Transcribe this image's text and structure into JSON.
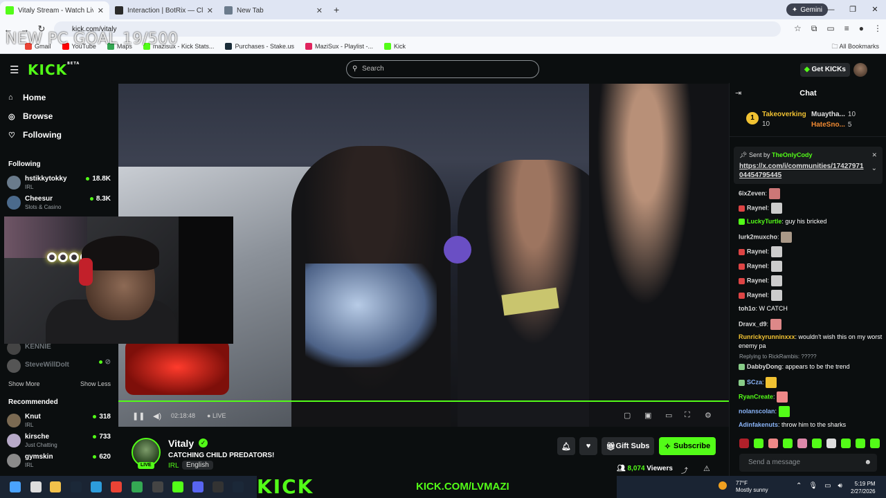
{
  "browser": {
    "tabs": [
      {
        "title": "Vitaly Stream - Watch Live on Kick",
        "active": true,
        "favicon_color": "#53fc18"
      },
      {
        "title": "Interaction | BotRix — Cloud St",
        "active": false,
        "favicon_color": "#2b2b2b"
      },
      {
        "title": "New Tab",
        "active": false,
        "favicon_color": "#6b7b8c"
      }
    ],
    "new_tab": "+",
    "gemini": "Gemini",
    "url": "kick.com/vitaly",
    "bookmarks": [
      {
        "label": "Gmail",
        "color": "#ea4335"
      },
      {
        "label": "YouTube",
        "color": "#ff0000"
      },
      {
        "label": "Maps",
        "color": "#34a853"
      },
      {
        "label": "mazisux - Kick Stats...",
        "color": "#53fc18"
      },
      {
        "label": "Purchases - Stake.us",
        "color": "#1a2c38"
      },
      {
        "label": "MaziSux - Playlist -...",
        "color": "#e0245e"
      },
      {
        "label": "Kick",
        "color": "#53fc18"
      }
    ],
    "all_bookmarks": "All Bookmarks"
  },
  "overlay": {
    "goal_text": "NEW PC GOAL 19/500"
  },
  "header": {
    "logo": "KICK",
    "logo_beta": "BETA",
    "search_placeholder": "Search",
    "get_kicks": "Get KICKs"
  },
  "sidebar": {
    "nav": [
      {
        "label": "Home",
        "icon": "home-icon"
      },
      {
        "label": "Browse",
        "icon": "browse-icon"
      },
      {
        "label": "Following",
        "icon": "heart-icon"
      }
    ],
    "following_heading": "Following",
    "following": [
      {
        "name": "hstikkytokky",
        "category": "IRL",
        "viewers": "18.8K",
        "color": "#6a7b8c"
      },
      {
        "name": "Cheesur",
        "category": "Slots & Casino",
        "viewers": "8.3K",
        "color": "#4b6a8c"
      }
    ],
    "offline": [
      {
        "name": "KENNIE",
        "color": "#444"
      },
      {
        "name": "SteveWillDoIt",
        "color": "#555"
      }
    ],
    "show_more": "Show More",
    "show_less": "Show Less",
    "recommended_heading": "Recommended",
    "recommended": [
      {
        "name": "Knut",
        "category": "IRL",
        "viewers": "318",
        "color": "#7b6a52"
      },
      {
        "name": "kirsche",
        "category": "Just Chatting",
        "viewers": "733",
        "color": "#b7a9c8"
      },
      {
        "name": "gymskin",
        "category": "IRL",
        "viewers": "620",
        "color": "#8a8a8a"
      }
    ]
  },
  "player": {
    "time": "02:18:48",
    "live_label": "LIVE",
    "progress_fraction": 1.0
  },
  "stream": {
    "name": "Vitaly",
    "title": "CATCHING CHILD PREDATORS!",
    "category": "IRL",
    "language": "English",
    "live_badge": "LIVE",
    "gift_subs": "Gift Subs",
    "subscribe": "Subscribe",
    "viewers_count": "8,074",
    "viewers_label": "Viewers"
  },
  "chat": {
    "title": "Chat",
    "leaderboard": [
      {
        "rank": "1",
        "name": "Takeoverking",
        "count": "10",
        "color": "#f1c232"
      },
      {
        "name": "Muaytha...",
        "count": "10",
        "color": "#e0e0e0"
      },
      {
        "name": "HateSno...",
        "count": "5",
        "color": "#f18a32"
      }
    ],
    "pinned": {
      "sent_by_label": "Sent by",
      "sender": "TheOnlyCody",
      "link": "https://x.com/i/communities/1742797104454795445"
    },
    "messages": [
      {
        "user": "6ixZeven",
        "text": "",
        "color": "#ddd",
        "emote": "#c77"
      },
      {
        "user": "Raynel",
        "text": "",
        "color": "#ddd",
        "emote": "#ccc"
      },
      {
        "user": "LuckyTurtle",
        "text": "guy his bricked",
        "color": "#53fc18"
      },
      {
        "user": "lurk2muxcho",
        "text": "",
        "color": "#ddd",
        "emote": "#a98"
      },
      {
        "user": "Raynel",
        "text": "",
        "color": "#ddd",
        "emote": "#ccc"
      },
      {
        "user": "Raynel",
        "text": "",
        "color": "#ddd",
        "emote": "#ccc"
      },
      {
        "user": "Raynel",
        "text": "",
        "color": "#ddd",
        "emote": "#ccc"
      },
      {
        "user": "Raynel",
        "text": "",
        "color": "#ddd",
        "emote": "#ccc"
      },
      {
        "user": "toh1o",
        "text": "W CATCH",
        "color": "#ddd"
      },
      {
        "user": "Dravx_d9",
        "text": "",
        "color": "#ddd",
        "emote": "#d88"
      },
      {
        "user": "Runrickyrunninxxx",
        "text": "wouldn't wish this on my worst enemy pa",
        "color": "#f1c232"
      },
      {
        "user": "DabbyDong",
        "text": "appears to be the trend",
        "color": "#ddd",
        "reply": "Replying to RickRambis: ?????"
      },
      {
        "user": "SCza",
        "text": "",
        "color": "#8ab4f8",
        "emote": "#f1c232"
      },
      {
        "user": "RyanCreate",
        "text": "",
        "color": "#53fc18",
        "emote": "#e88"
      },
      {
        "user": "nolanscolan",
        "text": "",
        "color": "#8ab4f8",
        "emote": "#53fc18"
      },
      {
        "user": "Adinfakenuts",
        "text": "throw him to the sharks",
        "color": "#8ab4f8"
      }
    ],
    "send_placeholder": "Send a message"
  },
  "taskbar": {
    "banner_big": "KICK",
    "banner_url": "KICK.COM/LVMAZI",
    "weather_temp": "77°F",
    "weather_desc": "Mostly sunny",
    "time": "5:19 PM",
    "date": "2/27/2026"
  }
}
